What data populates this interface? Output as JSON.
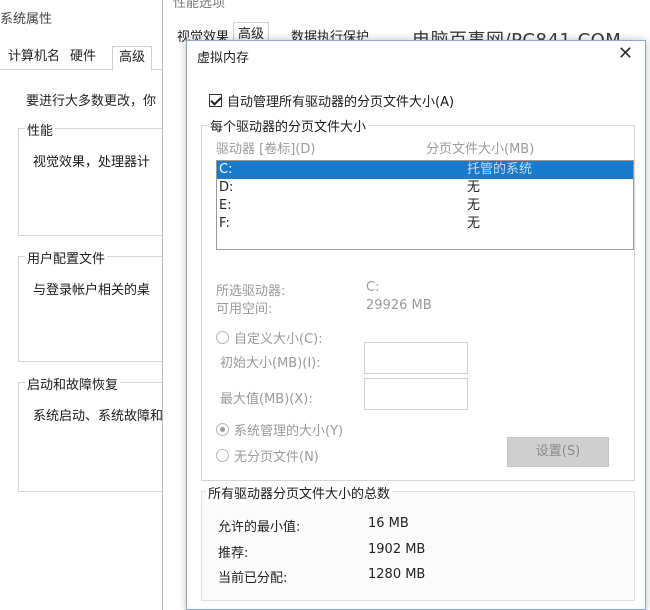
{
  "system_props": {
    "title": "系统属性",
    "tabs": [
      "计算机名",
      "硬件",
      "高级"
    ],
    "intro": "要进行大多数更改，你",
    "groups": [
      {
        "title": "性能",
        "desc": "视觉效果，处理器计"
      },
      {
        "title": "用户配置文件",
        "desc": "与登录帐户相关的桌"
      },
      {
        "title": "启动和故障恢复",
        "desc": "系统启动、系统故障和"
      }
    ]
  },
  "perf_options": {
    "title": "性能选项",
    "tabs": [
      "视觉效果",
      "高级",
      "数据执行保护"
    ]
  },
  "watermark": "电脑百事网/PC841.COM",
  "vm": {
    "title": "虚拟内存",
    "close": "✕",
    "auto_manage_label": "自动管理所有驱动器的分页文件大小(A)",
    "auto_manage_checked": true,
    "drive_group_title": "每个驱动器的分页文件大小",
    "drive_header": {
      "letter": "驱动器 [卷标](D)",
      "size": "分页文件大小(MB)"
    },
    "drives": [
      {
        "letter": "C:",
        "size": "托管的系统",
        "selected": true
      },
      {
        "letter": "D:",
        "size": "无",
        "selected": false
      },
      {
        "letter": "E:",
        "size": "无",
        "selected": false
      },
      {
        "letter": "F:",
        "size": "无",
        "selected": false
      }
    ],
    "selected_drive_label": "所选驱动器:",
    "selected_drive_value": "C:",
    "free_space_label": "可用空间:",
    "free_space_value": "29926 MB",
    "custom_size_label": "自定义大小(C):",
    "initial_size_label": "初始大小(MB)(I):",
    "max_size_label": "最大值(MB)(X):",
    "system_managed_label": "系统管理的大小(Y)",
    "no_paging_label": "无分页文件(N)",
    "set_button": "设置(S)",
    "totals_title": "所有驱动器分页文件大小的总数",
    "totals": [
      {
        "label": "允许的最小值:",
        "value": "16 MB"
      },
      {
        "label": "推荐:",
        "value": "1902 MB"
      },
      {
        "label": "当前已分配:",
        "value": "1280 MB"
      }
    ]
  }
}
